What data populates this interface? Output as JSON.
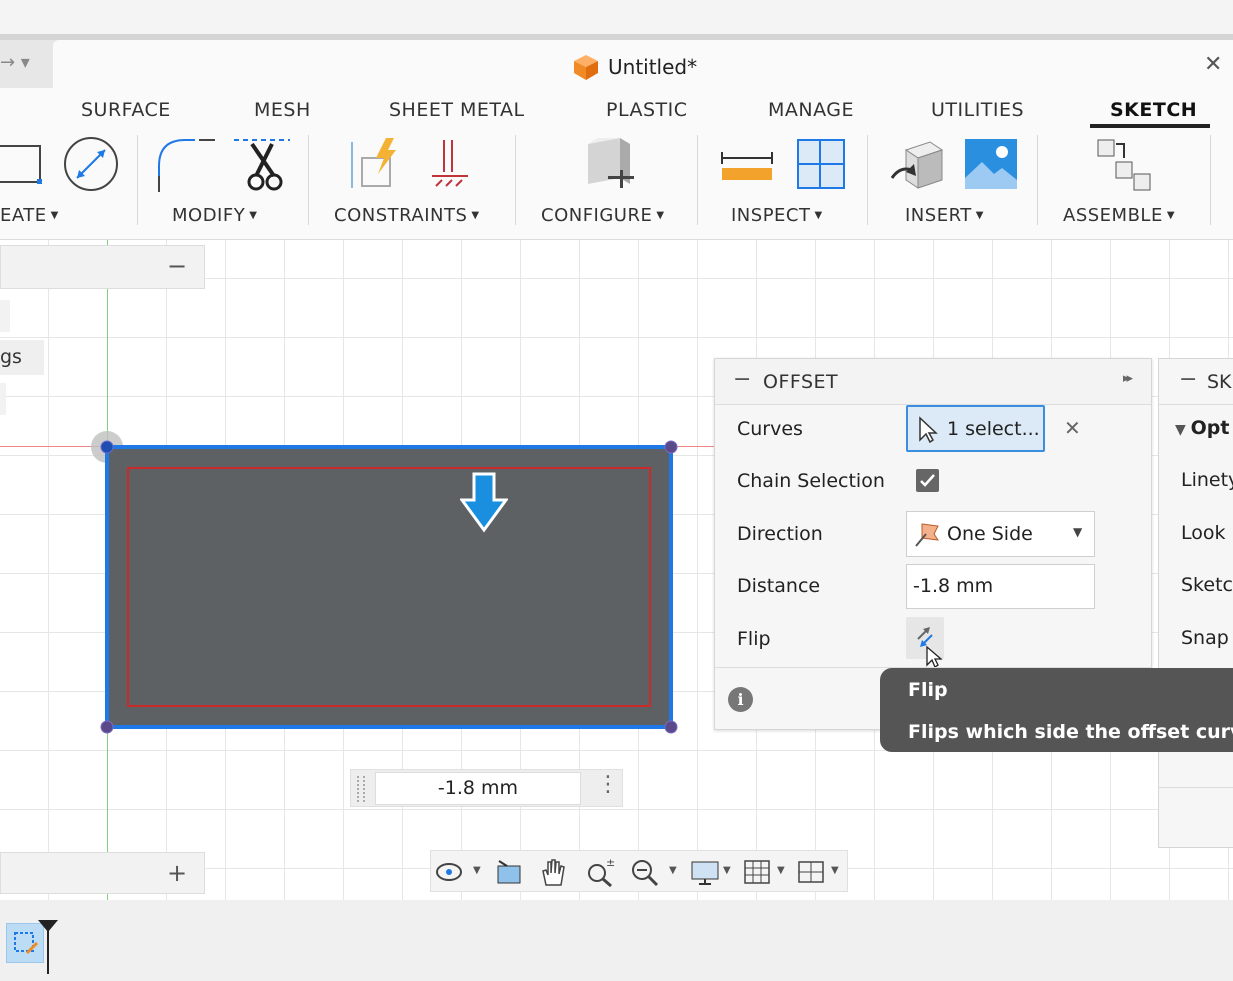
{
  "window": {
    "title": "Untitled*",
    "close_glyph": "✕",
    "icon": "cube-icon",
    "accent": "#f08a24"
  },
  "ribbon": {
    "tabs": [
      {
        "label": "SURFACE"
      },
      {
        "label": "MESH"
      },
      {
        "label": "SHEET METAL"
      },
      {
        "label": "PLASTIC"
      },
      {
        "label": "MANAGE"
      },
      {
        "label": "UTILITIES"
      },
      {
        "label": "SKETCH",
        "active": true
      }
    ],
    "groups": [
      {
        "label": "EATE",
        "caret": "▼"
      },
      {
        "label": "MODIFY",
        "caret": "▼"
      },
      {
        "label": "CONSTRAINTS",
        "caret": "▼"
      },
      {
        "label": "CONFIGURE",
        "caret": "▼"
      },
      {
        "label": "INSPECT",
        "caret": "▼"
      },
      {
        "label": "INSERT",
        "caret": "▼"
      },
      {
        "label": "ASSEMBLE",
        "caret": "▼"
      }
    ]
  },
  "browser": {
    "collapse_glyph": "−",
    "item_partial": "gs",
    "expand_glyph": "+"
  },
  "offset_dialog": {
    "title": "OFFSET",
    "collapse_glyph": "−",
    "expand_glyph": "▸▸",
    "curves_label": "Curves",
    "curves_value": "1 select...",
    "clear_glyph": "✕",
    "chain_label": "Chain Selection",
    "chain_checked": true,
    "direction_label": "Direction",
    "direction_value": "One Side",
    "distance_label": "Distance",
    "distance_value": "-1.8 mm",
    "flip_label": "Flip",
    "info_glyph": "i"
  },
  "tooltip": {
    "title": "Flip",
    "text": "Flips which side the offset curve i"
  },
  "sketch_palette": {
    "title": "SK",
    "collapse_glyph": "−",
    "section": "Opt",
    "rows": [
      "Linety",
      "Look",
      "Sketc",
      "Snap"
    ]
  },
  "canvas_input": {
    "value": "-1.8 mm",
    "more_glyph": "⋮"
  },
  "colors": {
    "selection_blue": "#1e78e6",
    "offset_red": "#cc2a2a",
    "fill": "#5d6163",
    "arrow_blue": "#1a8fe0"
  }
}
